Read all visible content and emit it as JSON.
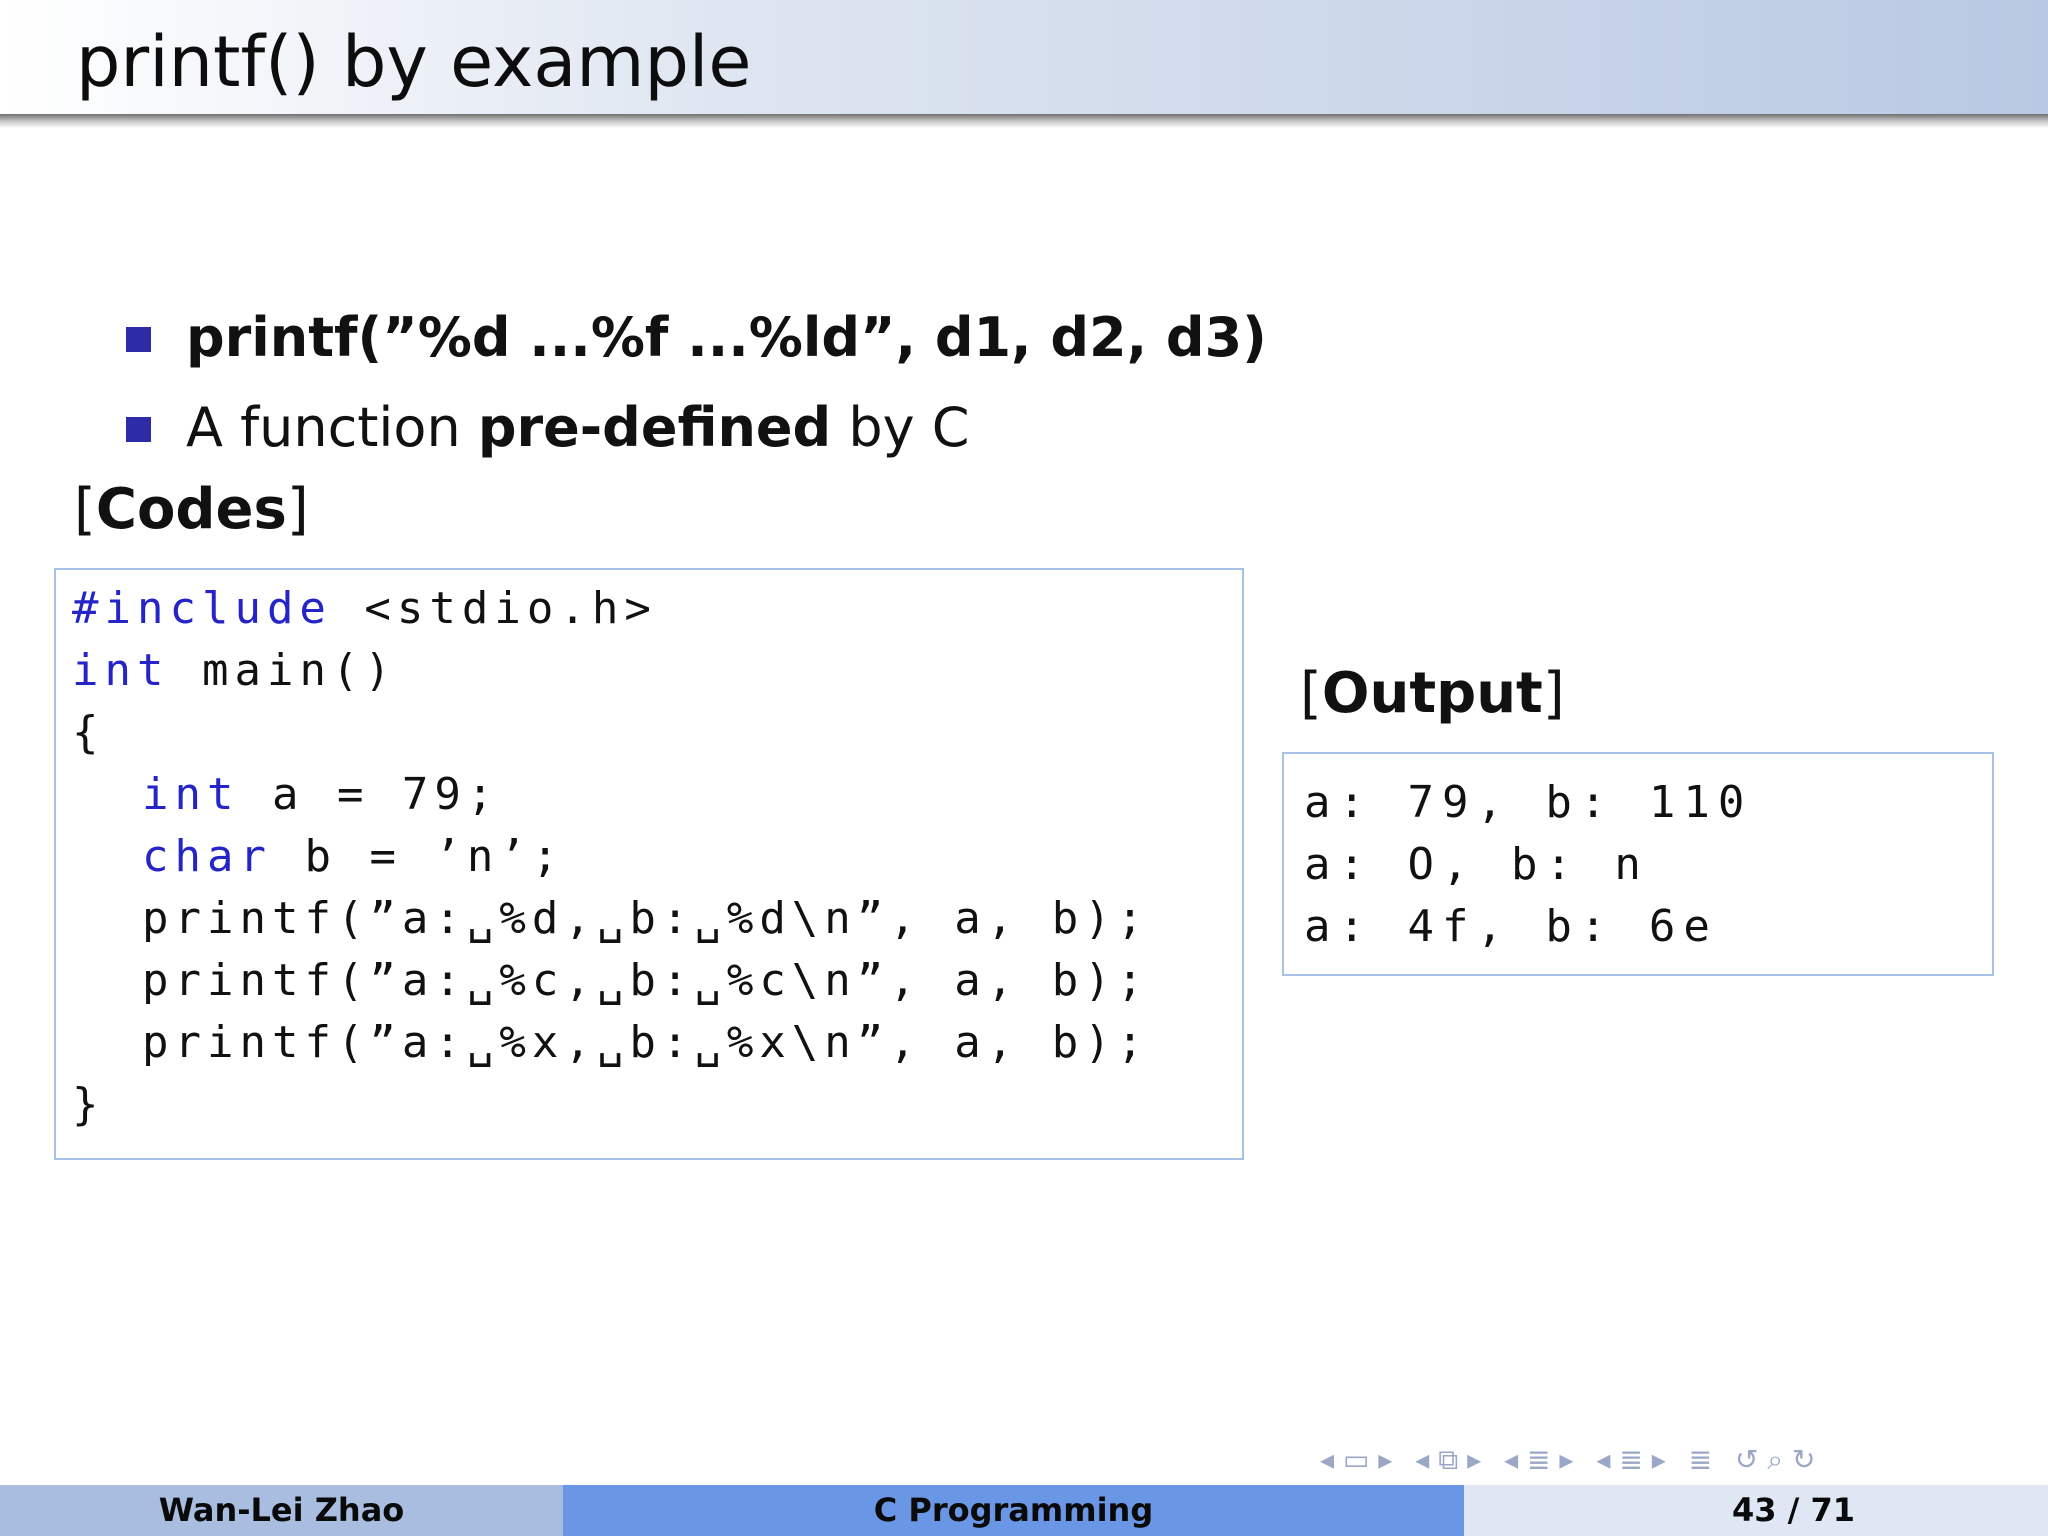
{
  "slide": {
    "title": "printf() by example",
    "bullets": {
      "b1": "printf(”%d ...%f ...%ld”, d1, d2, d3)",
      "b2_pre": "A function ",
      "b2_bold": "pre-defined",
      "b2_post": " by C"
    },
    "codes_label": "Codes",
    "output_label": "Output"
  },
  "code": {
    "l1_kw": "#include",
    "l1_rest": " <stdio.h>",
    "l2_kw": "int",
    "l2_rest": " main()",
    "l3": "{",
    "l4_kw": "int",
    "l4_rest": " a = 79;",
    "l5_kw": "char",
    "l5_rest": " b = ’n’;",
    "l6": "printf(”a:␣%d,␣b:␣%d\\n”, a, b);",
    "l7": "printf(”a:␣%c,␣b:␣%c\\n”, a, b);",
    "l8": "printf(”a:␣%x,␣b:␣%x\\n”, a, b);",
    "l9": "}"
  },
  "output": {
    "l1": "a: 79, b: 110",
    "l2": "a: O, b: n",
    "l3": "a: 4f, b: 6e"
  },
  "navigation": {
    "icons": [
      "nav-first-icon",
      "nav-frame-icon",
      "nav-subsection-icon",
      "nav-section-icon",
      "nav-toc-icon",
      "nav-search-icon"
    ]
  },
  "footer": {
    "author": "Wan-Lei Zhao",
    "course": "C Programming",
    "page": "43 / 71"
  },
  "colors": {
    "keyword": "#2424c8",
    "bullet": "#2d2ba6",
    "box_border": "#a7c2e6",
    "footer_left": "#a9bde0",
    "footer_mid": "#6a96e6"
  }
}
